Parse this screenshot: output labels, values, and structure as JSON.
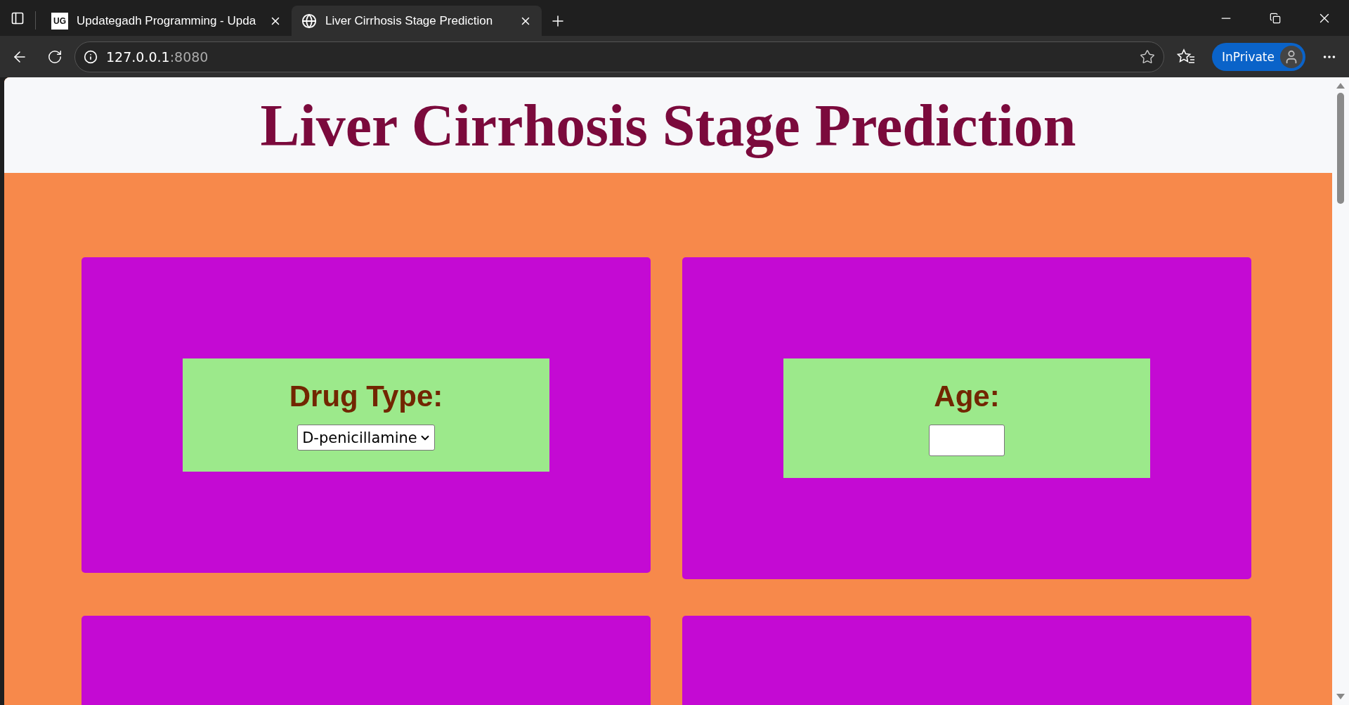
{
  "browser": {
    "tabs": [
      {
        "title": "Updategadh Programming - Upda",
        "kind": "logo",
        "selected": false
      },
      {
        "title": "Liver Cirrhosis Stage Prediction",
        "kind": "globe",
        "selected": true
      }
    ],
    "logo_text": "UG",
    "address": {
      "host": "127.0.0.1",
      "port": ":8080"
    },
    "profile": "InPrivate"
  },
  "page": {
    "title": "Liver Cirrhosis Stage Prediction",
    "fields": [
      {
        "label": "Drug Type:",
        "kind": "select",
        "value": "D-penicillamine"
      },
      {
        "label": "Age:",
        "kind": "input"
      }
    ]
  }
}
